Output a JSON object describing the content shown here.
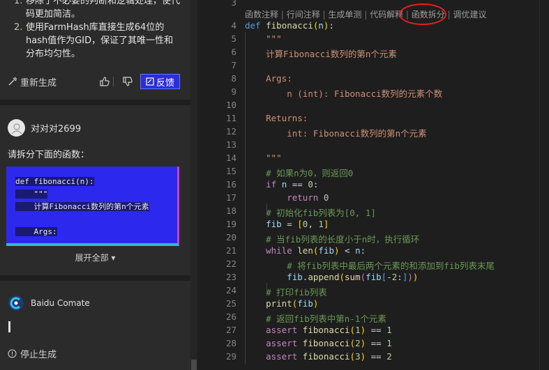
{
  "chat": {
    "summary_items": [
      {
        "num": "1.",
        "text": "移除了不必要的判断和逻辑处理，使代码更加简洁。"
      },
      {
        "num": "2.",
        "text": "使用FarmHash库直接生成64位的hash值作为GID，保证了其唯一性和分布均匀性。"
      }
    ],
    "regenerate_label": "重新生成",
    "feedback_label": "反馈",
    "user_name": "对对对2699",
    "user_prompt": "请拆分下面的函数：",
    "prompt_code_lines": [
      "def fibonacci(n):",
      "    \"\"\"",
      "    计算Fibonacci数列的第n个元素",
      "",
      "    Args:"
    ],
    "expand_label": "展开全部 ▾",
    "ai_name": "Baidu Comate",
    "stop_label": "停止生成",
    "accent_color": "#2c28ee"
  },
  "editor": {
    "codelens": [
      "函数注释",
      "行间注释",
      "生成单测",
      "代码解释",
      "函数拆分",
      "调优建议"
    ],
    "lines": [
      {
        "n": "3",
        "html": ""
      },
      {
        "n": "4",
        "html": "<span class='kw'>def</span> <span class='fn'>fibonacci</span><span class='par'>(</span><span class='var'>n</span><span class='par'>)</span>:"
      },
      {
        "n": "5",
        "html": "    <span class='str'>\"\"\"</span>"
      },
      {
        "n": "6",
        "html": "    <span class='str'>计算Fibonacci数列的第n个元素</span>"
      },
      {
        "n": "7",
        "html": ""
      },
      {
        "n": "8",
        "html": "    <span class='str'>Args:</span>"
      },
      {
        "n": "9",
        "html": "        <span class='str'>n (int): Fibonacci数列的元素个数</span>"
      },
      {
        "n": "10",
        "html": ""
      },
      {
        "n": "11",
        "html": "    <span class='str'>Returns:</span>"
      },
      {
        "n": "12",
        "html": "        <span class='str'>int: Fibonacci数列的第n个元素</span>"
      },
      {
        "n": "13",
        "html": ""
      },
      {
        "n": "14",
        "html": "    <span class='str'>\"\"\"</span>"
      },
      {
        "n": "15",
        "html": "    <span class='cm'># 如果n为0，则返回0</span>"
      },
      {
        "n": "16",
        "html": "    <span class='kw2'>if</span> <span class='var'>n</span> == <span class='num'>0</span>:"
      },
      {
        "n": "17",
        "html": "        <span class='kw2'>return</span> <span class='num'>0</span>"
      },
      {
        "n": "18",
        "html": "    <span class='cm'># 初始化fib列表为[0, 1]</span>"
      },
      {
        "n": "19",
        "html": "    <span class='var'>fib</span> = <span class='par'>[</span><span class='num'>0</span>, <span class='num'>1</span><span class='par'>]</span>"
      },
      {
        "n": "20",
        "html": "    <span class='cm'># 当fib列表的长度小于n时，执行循环</span>"
      },
      {
        "n": "21",
        "html": "    <span class='kw2'>while</span> <span class='fn'>len</span><span class='par'>(</span><span class='var'>fib</span><span class='par'>)</span> &lt; <span class='var'>n</span>:"
      },
      {
        "n": "22",
        "html": "        <span class='cm'># 将fib列表中最后两个元素的和添加到fib列表末尾</span>"
      },
      {
        "n": "23",
        "html": "        <span class='var'>fib</span>.<span class='fn'>append</span><span class='par'>(</span><span class='fn'>sum</span><span class='br'>(</span><span class='var'>fib</span><span class='kw'>[</span>-<span class='num'>2</span>:<span class='kw'>]</span><span class='br'>)</span><span class='par'>)</span>"
      },
      {
        "n": "24",
        "html": "    <span class='cm'># 打印fib列表</span>"
      },
      {
        "n": "25",
        "html": "    <span class='fn'>print</span><span class='par'>(</span><span class='var'>fib</span><span class='par'>)</span>"
      },
      {
        "n": "26",
        "html": "    <span class='cm'># 返回fib列表中第n-1个元素</span>"
      },
      {
        "n": "27",
        "html": "    <span class='kw2'>assert</span> <span class='fn'>fibonacci</span><span class='par'>(</span><span class='num'>1</span><span class='par'>)</span> == <span class='num'>1</span>"
      },
      {
        "n": "28",
        "html": "    <span class='kw2'>assert</span> <span class='fn'>fibonacci</span><span class='par'>(</span><span class='num'>2</span><span class='par'>)</span> == <span class='num'>1</span>"
      },
      {
        "n": "29",
        "html": "    <span class='kw2'>assert</span> <span class='fn'>fibonacci</span><span class='par'>(</span><span class='num'>3</span><span class='par'>)</span> == <span class='num'>2</span>"
      }
    ]
  }
}
